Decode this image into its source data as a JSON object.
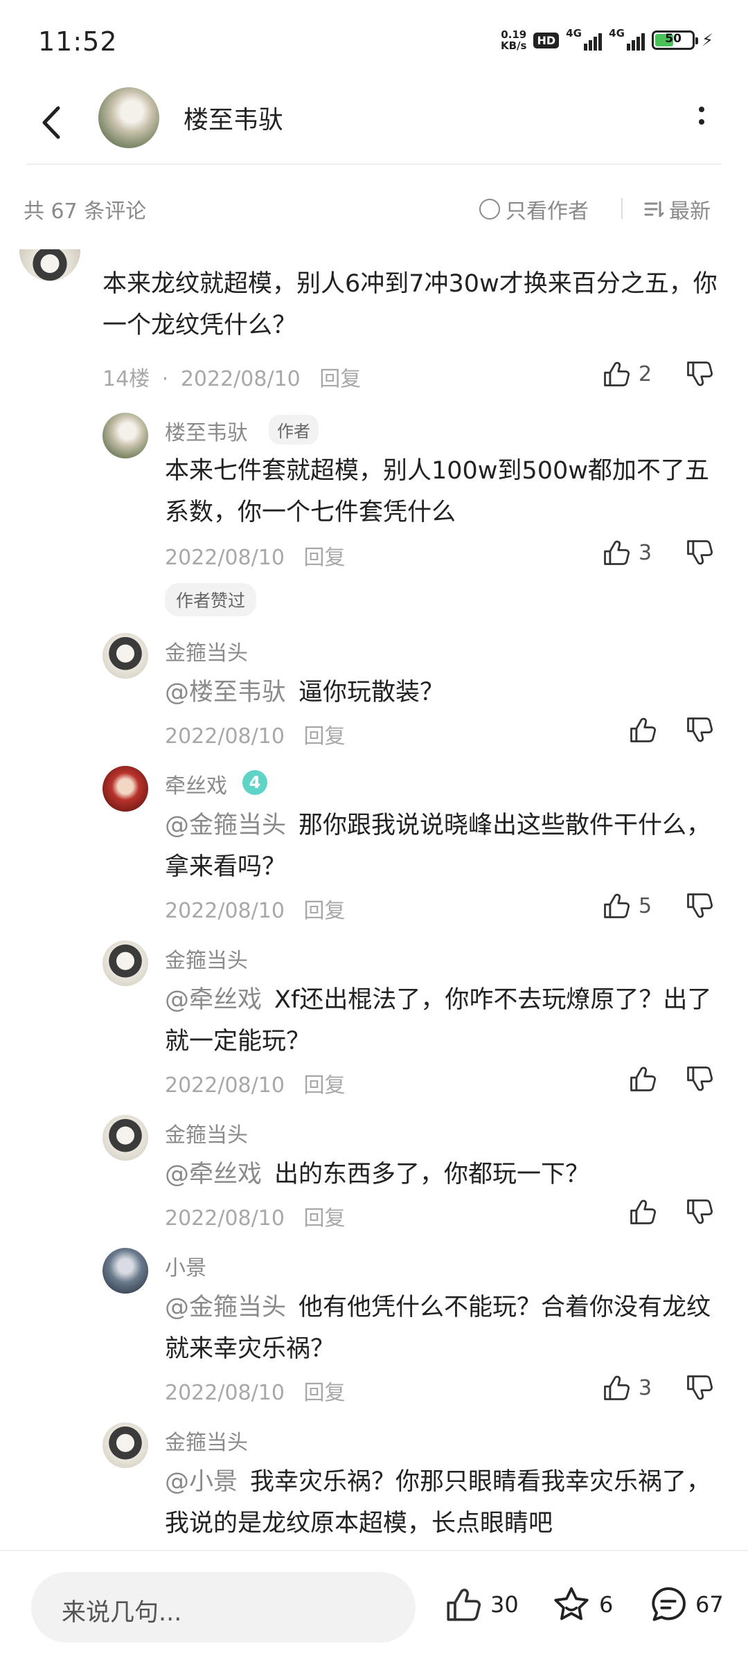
{
  "status_bar": {
    "time": "11:52",
    "net_speed": "0.19",
    "net_unit": "KB/s",
    "hd": "HD",
    "sim1": "4G",
    "sim2": "4G",
    "battery": "50"
  },
  "header": {
    "title": "楼至韦驮"
  },
  "filter": {
    "count": "共 67 条评论",
    "only_author": "只看作者",
    "sort": "最新"
  },
  "main_comment": {
    "content": "本来龙纹就超模，别人6冲到7冲30w才换来百分之五，你一个龙纹凭什么？",
    "floor": "14楼",
    "date": "2022/08/10",
    "reply": "回复",
    "likes": "2"
  },
  "replies": [
    {
      "name": "楼至韦驮",
      "tag": "作者",
      "content": "本来七件套就超模，别人100w到500w都加不了五系数，你一个七件套凭什么",
      "date": "2022/08/10",
      "reply": "回复",
      "likes": "3",
      "liked_tag": "作者赞过"
    },
    {
      "name": "金箍当头",
      "mention": "@楼至韦驮",
      "content": "逼你玩散装？",
      "date": "2022/08/10",
      "reply": "回复",
      "likes": ""
    },
    {
      "name": "牵丝戏",
      "level": "4",
      "mention": "@金箍当头",
      "content": "那你跟我说说晓峰出这些散件干什么，拿来看吗？",
      "date": "2022/08/10",
      "reply": "回复",
      "likes": "5"
    },
    {
      "name": "金箍当头",
      "mention": "@牵丝戏",
      "content": "Xf还出棍法了，你咋不去玩燎原了？出了就一定能玩？",
      "date": "2022/08/10",
      "reply": "回复",
      "likes": ""
    },
    {
      "name": "金箍当头",
      "mention": "@牵丝戏",
      "content": "出的东西多了，你都玩一下？",
      "date": "2022/08/10",
      "reply": "回复",
      "likes": ""
    },
    {
      "name": "小景",
      "mention": "@金箍当头",
      "content": "他有他凭什么不能玩？合着你没有龙纹就来幸灾乐祸？",
      "date": "2022/08/10",
      "reply": "回复",
      "likes": "3"
    },
    {
      "name": "金箍当头",
      "mention": "@小景",
      "content": "我幸灾乐祸？你那只眼睛看我幸灾乐祸了，我说的是龙纹原本超模，长点眼睛吧"
    }
  ],
  "bottom_bar": {
    "input_placeholder": "来说几句...",
    "likes": "30",
    "favorites": "6",
    "comments": "67"
  }
}
